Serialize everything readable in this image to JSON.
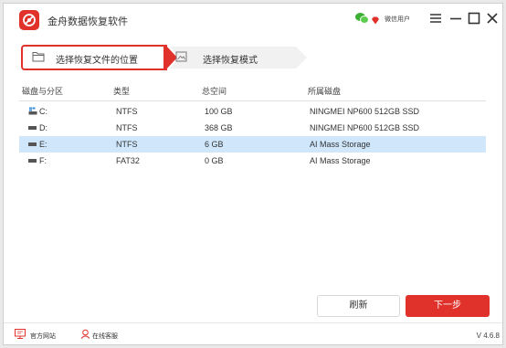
{
  "app": {
    "title": "金舟数据恢复软件",
    "user_label": "微信用户",
    "accent_color": "#e0312b",
    "icons": [
      "app-logo-icon",
      "wechat-icon",
      "vip-diamond-icon",
      "menu-icon",
      "minimize-icon",
      "maximize-icon",
      "close-icon"
    ]
  },
  "steps": [
    {
      "label": "选择恢复文件的位置",
      "icon": "folder-icon",
      "active": true
    },
    {
      "label": "选择恢复模式",
      "icon": "image-icon",
      "active": false
    }
  ],
  "table": {
    "headers": [
      "磁盘与分区",
      "类型",
      "总空间",
      "所属磁盘"
    ],
    "rows": [
      {
        "drive": "C:",
        "type": "NTFS",
        "size": "100 GB",
        "disk": "NINGMEI NP600 512GB SSD",
        "icon": "system-drive-icon",
        "selected": false
      },
      {
        "drive": "D:",
        "type": "NTFS",
        "size": "368 GB",
        "disk": "NINGMEI NP600 512GB SSD",
        "icon": "drive-icon",
        "selected": false
      },
      {
        "drive": "E:",
        "type": "NTFS",
        "size": "6 GB",
        "disk": "AI Mass Storage",
        "icon": "drive-icon",
        "selected": true
      },
      {
        "drive": "F:",
        "type": "FAT32",
        "size": "0 GB",
        "disk": "AI Mass Storage",
        "icon": "drive-icon",
        "selected": false
      }
    ]
  },
  "buttons": {
    "refresh": "刷新",
    "next": "下一步"
  },
  "footer": {
    "website": "官方网站",
    "support": "在线客服",
    "version": "V 4.6.8"
  }
}
